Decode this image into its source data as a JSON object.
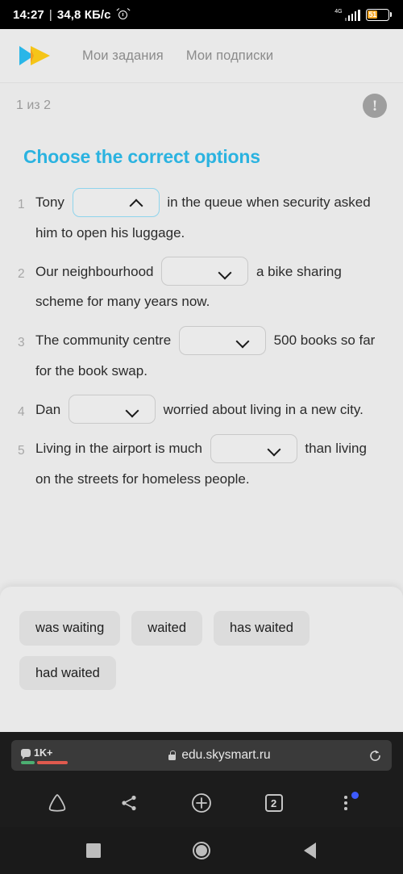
{
  "status_bar": {
    "time": "14:27",
    "separator": "|",
    "network_speed": "34,8 КБ/с",
    "alarm_icon": "alarm-clock-icon",
    "network_type": "4G",
    "battery_level": "51",
    "battery_color": "#f5a623"
  },
  "site_header": {
    "logo_icon": "skysmart-double-play-logo",
    "logo_colors": [
      "#29b6e8",
      "#f5c518",
      "#f2a020"
    ],
    "nav": [
      {
        "label": "Мои задания"
      },
      {
        "label": "Мои подписки"
      }
    ]
  },
  "progress": {
    "text": "1 из 2",
    "warning_icon": "exclamation-circle-icon",
    "warning_color": "#9e9e9e"
  },
  "task": {
    "title": "Choose the correct options",
    "title_color": "#2bb3e0",
    "questions": [
      {
        "number": "1",
        "before": "Tony",
        "after": "in the queue when security asked him to open his luggage.",
        "dropdown_value": "",
        "dropdown_state": "open",
        "chevron": "chevron-up-icon"
      },
      {
        "number": "2",
        "before": "Our neighbourhood",
        "after": "a bike sharing scheme for many years now.",
        "dropdown_value": "",
        "dropdown_state": "closed",
        "chevron": "chevron-down-icon"
      },
      {
        "number": "3",
        "before": "The community centre",
        "after": "500 books so far for the book swap.",
        "dropdown_value": "",
        "dropdown_state": "closed",
        "chevron": "chevron-down-icon"
      },
      {
        "number": "4",
        "before": "Dan",
        "after": "worried about living in a new city.",
        "dropdown_value": "",
        "dropdown_state": "closed",
        "chevron": "chevron-down-icon"
      },
      {
        "number": "5",
        "before": "Living in the airport is much",
        "after": "than living on the streets for homeless people.",
        "dropdown_value": "",
        "dropdown_state": "closed",
        "chevron": "chevron-down-icon"
      }
    ]
  },
  "options_panel": {
    "options": [
      {
        "label": "was waiting"
      },
      {
        "label": "waited"
      },
      {
        "label": "has waited"
      },
      {
        "label": "had waited"
      }
    ]
  },
  "browser": {
    "omnibox": {
      "comment_icon": "speech-bubble-icon",
      "comment_count": "1K+",
      "lock_icon": "lock-icon",
      "url": "edu.skysmart.ru",
      "reload_icon": "reload-icon"
    },
    "toolbar": [
      {
        "icon": "home-icon"
      },
      {
        "icon": "share-icon"
      },
      {
        "icon": "new-tab-plus-icon"
      },
      {
        "icon": "tab-switcher-icon",
        "count": "2"
      },
      {
        "icon": "overflow-menu-icon",
        "badge": true,
        "badge_color": "#3d5afe"
      }
    ]
  },
  "android_nav": {
    "recents_icon": "recents-square-icon",
    "home_icon": "home-circle-icon",
    "back_icon": "back-triangle-icon"
  }
}
